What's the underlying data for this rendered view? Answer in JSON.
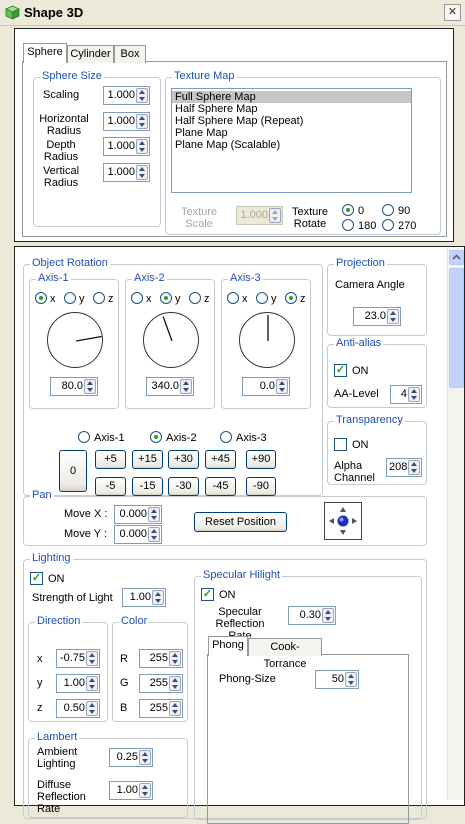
{
  "window": {
    "title": "Shape 3D",
    "close_glyph": "✕",
    "icon": "cube-icon"
  },
  "tabs": [
    {
      "label": "Sphere",
      "active": true
    },
    {
      "label": "Cylinder",
      "active": false
    },
    {
      "label": "Box",
      "active": false
    }
  ],
  "sphere_size": {
    "title": "Sphere Size",
    "scaling": {
      "label": "Scaling",
      "value": "1.000"
    },
    "horizontal": {
      "label": "Horizontal Radius",
      "value": "1.000"
    },
    "depth": {
      "label": "Depth Radius",
      "value": "1.000"
    },
    "vertical": {
      "label": "Vertical Radius",
      "value": "1.000"
    }
  },
  "texture_map": {
    "title": "Texture Map",
    "items": [
      "Full Sphere Map",
      "Half Sphere Map",
      "Half Sphere Map (Repeat)",
      "Plane Map",
      "Plane Map (Scalable)"
    ],
    "selected": 0,
    "texture_scale": {
      "label": "Texture Scale",
      "value": "1.000"
    },
    "texture_rotate": {
      "label": "Texture Rotate",
      "options": [
        "0",
        "90",
        "180",
        "270"
      ],
      "selected": "0"
    }
  },
  "object_rotation": {
    "title": "Object Rotation",
    "axes": [
      {
        "title": "Axis-1",
        "selected": "x",
        "value": "80.0",
        "angle_deg": 80
      },
      {
        "title": "Axis-2",
        "selected": "y",
        "value": "340.0",
        "angle_deg": 340
      },
      {
        "title": "Axis-3",
        "selected": "z",
        "value": "0.0",
        "angle_deg": 0
      }
    ],
    "xyz": [
      "x",
      "y",
      "z"
    ],
    "axis_select": [
      "Axis-1",
      "Axis-2",
      "Axis-3"
    ],
    "axis_selected": "Axis-2",
    "zero_label": "0",
    "plus_buttons": [
      "+5",
      "+15",
      "+30",
      "+45",
      "+90"
    ],
    "minus_buttons": [
      "-5",
      "-15",
      "-30",
      "-45",
      "-90"
    ]
  },
  "projection": {
    "title": "Projection",
    "camera_label": "Camera Angle",
    "camera_value": "23.0"
  },
  "antialias": {
    "title": "Anti-alias",
    "on_label": "ON",
    "on": true,
    "level_label": "AA-Level",
    "level_value": "4"
  },
  "transparency": {
    "title": "Transparency",
    "on_label": "ON",
    "on": false,
    "alpha_label": "Alpha Channel",
    "alpha_value": "208"
  },
  "pan": {
    "title": "Pan",
    "move_x_label": "Move X :",
    "move_x_value": "0.000",
    "move_y_label": "Move Y :",
    "move_y_value": "0.000",
    "reset_label": "Reset Position",
    "move_icon": "four-way-arrows-icon"
  },
  "lighting": {
    "title": "Lighting",
    "on_label": "ON",
    "on": true,
    "strength_label": "Strength of Light",
    "strength_value": "1.00",
    "direction": {
      "title": "Direction",
      "x_label": "x",
      "x": "-0.75",
      "y_label": "y",
      "y": "1.00",
      "z_label": "z",
      "z": "0.50"
    },
    "color": {
      "title": "Color",
      "r_label": "R",
      "r": "255",
      "g_label": "G",
      "g": "255",
      "b_label": "B",
      "b": "255"
    },
    "lambert": {
      "title": "Lambert",
      "ambient_label": "Ambient Lighting",
      "ambient_value": "0.25",
      "diffuse_label": "Diffuse Reflection Rate",
      "diffuse_value": "1.00"
    },
    "specular": {
      "title": "Specular Hilight",
      "on_label": "ON",
      "on": true,
      "rate_label": "Specular Reflection Rate",
      "rate_value": "0.30",
      "tabs": [
        {
          "label": "Phong",
          "active": true
        },
        {
          "label": "Cook-Torrance",
          "active": false
        }
      ],
      "phong_label": "Phong-Size",
      "phong_value": "50"
    }
  }
}
